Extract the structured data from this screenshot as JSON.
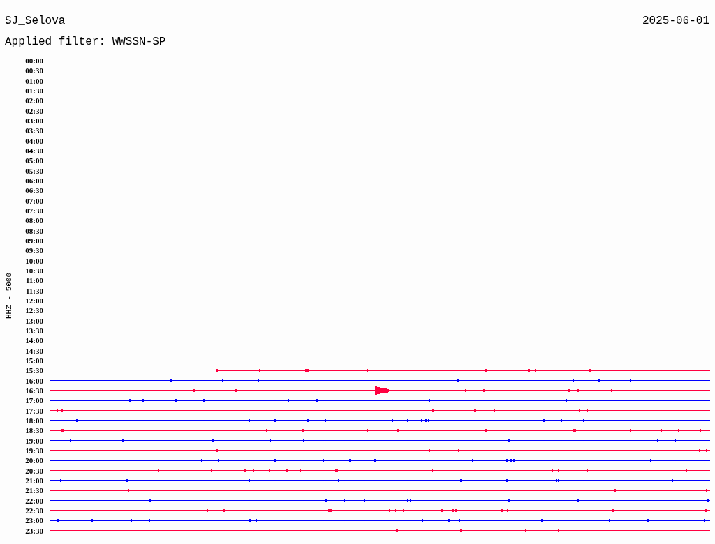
{
  "station": "SJ_Selova",
  "date": "2025-06-01",
  "filter": "Applied filter: WWSSN-SP",
  "axis_label": "HHZ - 5000",
  "rows": [
    {
      "label": "00:00"
    },
    {
      "label": "00:30"
    },
    {
      "label": "01:00"
    },
    {
      "label": "01:30"
    },
    {
      "label": "02:00"
    },
    {
      "label": "02:30"
    },
    {
      "label": "03:00"
    },
    {
      "label": "03:30"
    },
    {
      "label": "04:00"
    },
    {
      "label": "04:30"
    },
    {
      "label": "05:00"
    },
    {
      "label": "05:30"
    },
    {
      "label": "06:00"
    },
    {
      "label": "06:30"
    },
    {
      "label": "07:00"
    },
    {
      "label": "07:30"
    },
    {
      "label": "08:00"
    },
    {
      "label": "08:30"
    },
    {
      "label": "09:00"
    },
    {
      "label": "09:30"
    },
    {
      "label": "10:00"
    },
    {
      "label": "10:30"
    },
    {
      "label": "11:00"
    },
    {
      "label": "11:30"
    },
    {
      "label": "12:00"
    },
    {
      "label": "12:30"
    },
    {
      "label": "13:00"
    },
    {
      "label": "13:30"
    },
    {
      "label": "14:00"
    },
    {
      "label": "14:30"
    },
    {
      "label": "15:00"
    },
    {
      "label": "15:30",
      "trace": {
        "kind": "noise",
        "color": "#ff0040",
        "level": 0.746
      }
    },
    {
      "label": "16:00",
      "trace": {
        "kind": "noise",
        "color": "#0000ff",
        "level": 1
      }
    },
    {
      "label": "16:30",
      "trace": {
        "kind": "quake",
        "color": "#ff0040",
        "level": 1
      }
    },
    {
      "label": "17:00",
      "trace": {
        "kind": "noise",
        "color": "#0000ff",
        "level": 1
      }
    },
    {
      "label": "17:30",
      "trace": {
        "kind": "noise",
        "color": "#ff0040",
        "level": 1
      }
    },
    {
      "label": "18:00",
      "trace": {
        "kind": "noise",
        "color": "#0000ff",
        "level": 1
      }
    },
    {
      "label": "18:30",
      "trace": {
        "kind": "noise",
        "color": "#ff0040",
        "level": 1
      }
    },
    {
      "label": "19:00",
      "trace": {
        "kind": "noise",
        "color": "#0000ff",
        "level": 1
      }
    },
    {
      "label": "19:30",
      "trace": {
        "kind": "noise",
        "color": "#ff0040",
        "level": 1
      }
    },
    {
      "label": "20:00",
      "trace": {
        "kind": "noise",
        "color": "#0000ff",
        "level": 1
      }
    },
    {
      "label": "20:30",
      "trace": {
        "kind": "noise",
        "color": "#ff0040",
        "level": 1
      }
    },
    {
      "label": "21:00",
      "trace": {
        "kind": "noise",
        "color": "#0000ff",
        "level": 1
      }
    },
    {
      "label": "21:30",
      "trace": {
        "kind": "noise",
        "color": "#ff0040",
        "level": 1
      }
    },
    {
      "label": "22:00",
      "trace": {
        "kind": "noise",
        "color": "#0000ff",
        "level": 1
      }
    },
    {
      "label": "22:30",
      "trace": {
        "kind": "noise",
        "color": "#ff0040",
        "level": 1
      }
    },
    {
      "label": "23:00",
      "trace": {
        "kind": "noise",
        "color": "#0000ff",
        "level": 1
      }
    },
    {
      "label": "23:30",
      "trace": {
        "kind": "noise",
        "color": "#ff0040",
        "level": 1
      }
    }
  ]
}
